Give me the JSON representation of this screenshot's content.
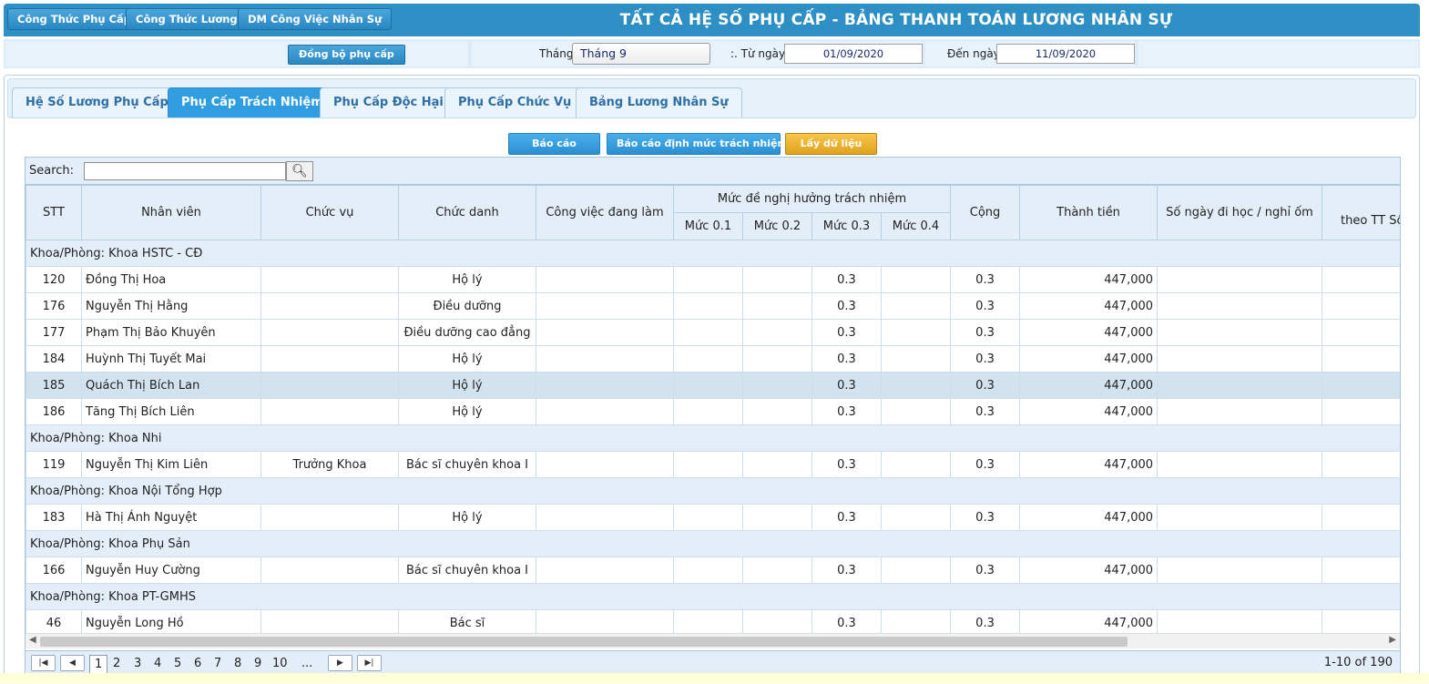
{
  "toolbar": {
    "buttons": [
      "Công Thức Phụ Cấp",
      "Công Thức Lương",
      "DM Công Việc Nhân Sự"
    ],
    "title": "TẤT CẢ HỆ SỐ PHỤ CẤP - BẢNG THANH TOÁN LƯƠNG NHÂN SỰ"
  },
  "filter": {
    "sync_label": "Đồng bộ phụ cấp",
    "month_label": "Tháng",
    "month_value": "Tháng 9",
    "from_label": ":. Từ ngày",
    "from_value": "01/09/2020",
    "to_label": "Đến ngày",
    "to_value": "11/09/2020"
  },
  "tabs": [
    "Hệ Số Lương Phụ Cấp",
    "Phụ Cấp Trách Nhiệm",
    "Phụ Cấp Độc Hại",
    "Phụ Cấp Chức Vụ",
    "Bảng Lương Nhân Sự"
  ],
  "active_tab": 1,
  "actions": {
    "report": "Báo cáo",
    "report_norm": "Báo cáo định mức trách nhiệm",
    "fetch": "Lấy dữ liệu"
  },
  "grid": {
    "search_label": "Search:",
    "search_value": "",
    "columns": {
      "stt": "STT",
      "employee": "Nhân viên",
      "position": "Chức vụ",
      "title": "Chức danh",
      "job": "Công việc đang làm",
      "level_group": "Mức đề nghị hưởng trách nhiệm",
      "levels": [
        "Mức 0.1",
        "Mức 0.2",
        "Mức 0.3",
        "Mức 0.4"
      ],
      "total": "Cộng",
      "amount": "Thành tiền",
      "days": "Số ngày đi học / nghỉ ốm",
      "cut_top": "S",
      "cut_bottom": "theo TT Số"
    },
    "groups": [
      {
        "label": "Khoa/Phòng: Khoa HSTC - CĐ",
        "rows": [
          {
            "stt": "120",
            "name": "Đồng Thị Hoa",
            "position": "",
            "title": "Hộ lý",
            "job": "",
            "m1": "",
            "m2": "",
            "m3": "0.3",
            "m4": "",
            "total": "0.3",
            "amount": "447,000",
            "days": ""
          },
          {
            "stt": "176",
            "name": "Nguyễn Thị Hằng",
            "position": "",
            "title": "Điều dưỡng",
            "job": "",
            "m1": "",
            "m2": "",
            "m3": "0.3",
            "m4": "",
            "total": "0.3",
            "amount": "447,000",
            "days": ""
          },
          {
            "stt": "177",
            "name": "Phạm Thị Bảo Khuyên",
            "position": "",
            "title": "Điều dưỡng cao đẳng",
            "job": "",
            "m1": "",
            "m2": "",
            "m3": "0.3",
            "m4": "",
            "total": "0.3",
            "amount": "447,000",
            "days": ""
          },
          {
            "stt": "184",
            "name": "Huỳnh Thị Tuyết Mai",
            "position": "",
            "title": "Hộ lý",
            "job": "",
            "m1": "",
            "m2": "",
            "m3": "0.3",
            "m4": "",
            "total": "0.3",
            "amount": "447,000",
            "days": ""
          },
          {
            "stt": "185",
            "name": "Quách Thị Bích Lan",
            "position": "",
            "title": "Hộ lý",
            "job": "",
            "m1": "",
            "m2": "",
            "m3": "0.3",
            "m4": "",
            "total": "0.3",
            "amount": "447,000",
            "days": "",
            "selected": true
          },
          {
            "stt": "186",
            "name": "Tăng Thị Bích Liên",
            "position": "",
            "title": "Hộ lý",
            "job": "",
            "m1": "",
            "m2": "",
            "m3": "0.3",
            "m4": "",
            "total": "0.3",
            "amount": "447,000",
            "days": ""
          }
        ]
      },
      {
        "label": "Khoa/Phòng: Khoa Nhi",
        "rows": [
          {
            "stt": "119",
            "name": "Nguyễn Thị Kim Liên",
            "position": "Trưởng Khoa",
            "title": "Bác sĩ chuyên khoa I",
            "job": "",
            "m1": "",
            "m2": "",
            "m3": "0.3",
            "m4": "",
            "total": "0.3",
            "amount": "447,000",
            "days": ""
          }
        ]
      },
      {
        "label": "Khoa/Phòng: Khoa Nội Tổng Hợp",
        "rows": [
          {
            "stt": "183",
            "name": "Hà Thị Ánh Nguyệt",
            "position": "",
            "title": "Hộ lý",
            "job": "",
            "m1": "",
            "m2": "",
            "m3": "0.3",
            "m4": "",
            "total": "0.3",
            "amount": "447,000",
            "days": ""
          }
        ]
      },
      {
        "label": "Khoa/Phòng: Khoa Phụ Sản",
        "rows": [
          {
            "stt": "166",
            "name": "Nguyễn Huy Cường",
            "position": "",
            "title": "Bác sĩ chuyên khoa I",
            "job": "",
            "m1": "",
            "m2": "",
            "m3": "0.3",
            "m4": "",
            "total": "0.3",
            "amount": "447,000",
            "days": ""
          }
        ]
      },
      {
        "label": "Khoa/Phòng: Khoa PT-GMHS",
        "rows": [
          {
            "stt": "46",
            "name": "Nguyễn Long Hồ",
            "position": "",
            "title": "Bác sĩ",
            "job": "",
            "m1": "",
            "m2": "",
            "m3": "0.3",
            "m4": "",
            "total": "0.3",
            "amount": "447,000",
            "days": ""
          }
        ]
      }
    ]
  },
  "pager": {
    "pages": [
      "1",
      "2",
      "3",
      "4",
      "5",
      "6",
      "7",
      "8",
      "9",
      "10",
      "..."
    ],
    "current": "1",
    "info": "1-10 of 190"
  }
}
